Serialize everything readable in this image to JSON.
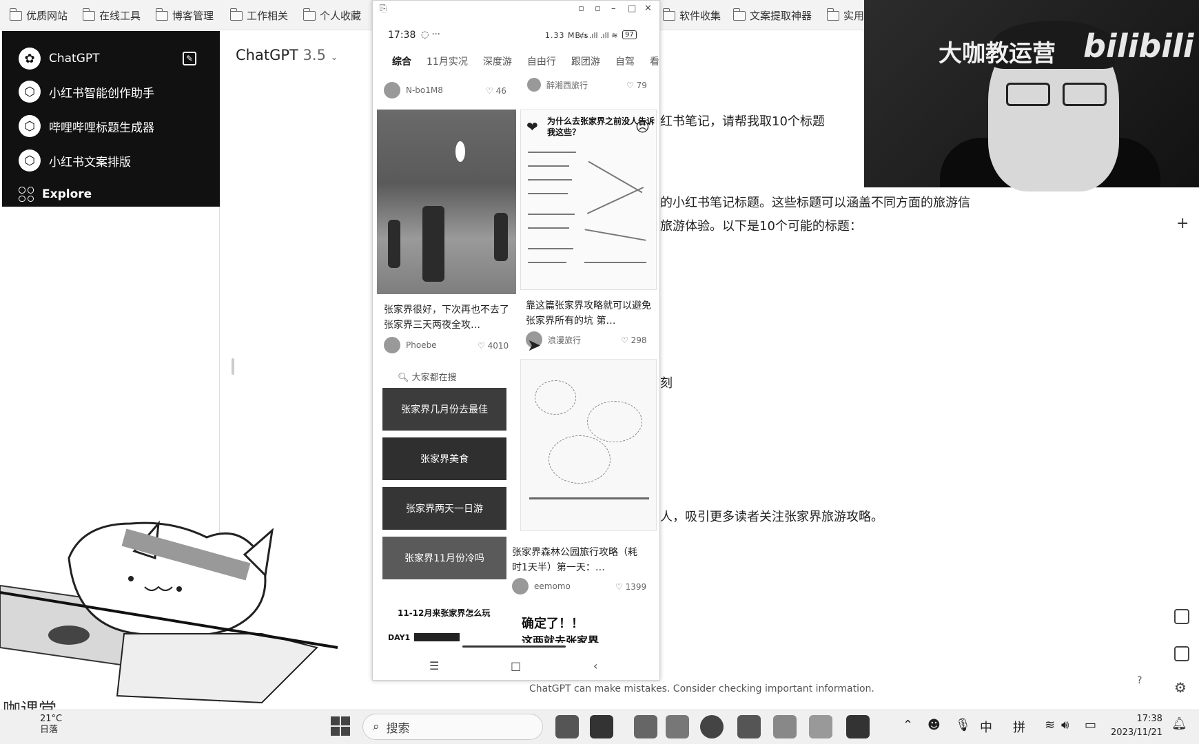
{
  "bookmarks": [
    "优质网站",
    "在线工具",
    "博客管理",
    "工作相关",
    "个人收藏",
    "软件收集",
    "文案提取神器",
    "实用"
  ],
  "sidebar": {
    "items": [
      {
        "label": "ChatGPT"
      },
      {
        "label": "小红书智能创作助手"
      },
      {
        "label": "哔哩哔哩标题生成器"
      },
      {
        "label": "小红书文案排版"
      },
      {
        "label": "Explore"
      }
    ]
  },
  "model": {
    "name": "ChatGPT",
    "version": "3.5"
  },
  "response": {
    "lines": [
      "红书笔记，请帮我取10个标题",
      "的小红书笔记标题。这些标题可以涵盖不同方面的旅游信",
      "旅游体验。以下是10个可能的标题：",
      "刻",
      "人，吸引更多读者关注张家界旅游攻略。"
    ]
  },
  "footer": {
    "note": "ChatGPT can make mistakes. Consider checking important information.",
    "help": "?"
  },
  "phone": {
    "time": "17:38",
    "signal": "1.33 MB/s",
    "battery": "97",
    "tabs": [
      "综合",
      "11月实况",
      "深度游",
      "自由行",
      "跟团游",
      "自驾",
      "看"
    ],
    "top_row": [
      {
        "author": "N-bo1M8",
        "likes": "46"
      },
      {
        "author": "醉湘西旅行",
        "likes": "79"
      }
    ],
    "infographic_title": "为什么去张家界之前没人告诉我这些？",
    "cards": [
      {
        "title": "张家界很好，下次再也不去了 张家界三天两夜全攻…",
        "author": "Phoebe",
        "likes": "4010"
      },
      {
        "title": "靠这篇张家界攻略就可以避免张家界所有的坑 第…",
        "author": "浪漫旅行",
        "likes": "298"
      },
      {
        "title": "张家界森林公园旅行攻略（耗时1天半）第一天：…",
        "author": "eemomo",
        "likes": "1399"
      }
    ],
    "search": {
      "label": "大家都在搜",
      "chips": [
        "张家界几月份去最佳",
        "张家界美食",
        "张家界两天一日游",
        "张家界11月份冷吗"
      ]
    },
    "bottom_left": "11-12月来张家界怎么玩",
    "bottom_right": "确定了！！",
    "bottom_right2": "这两就去张家界",
    "day": "DAY1"
  },
  "cam": {
    "title": "大咖教运营",
    "logo": "bilibili"
  },
  "watermark": "咖课堂",
  "taskbar": {
    "weather_temp": "21°C",
    "weather_desc": "日落",
    "search_placeholder": "搜索",
    "ime1": "中",
    "ime2": "拼",
    "time": "17:38",
    "date": "2023/11/21"
  }
}
